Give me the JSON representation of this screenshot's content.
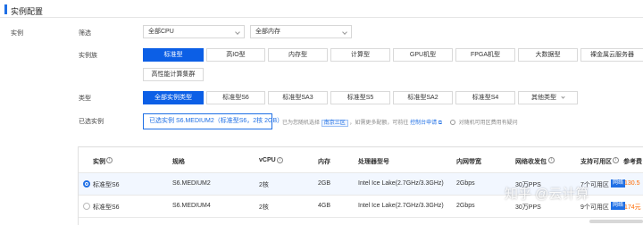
{
  "section": {
    "title": "实例配置"
  },
  "labels": {
    "instance": "实例",
    "filter": "筛选",
    "family": "实例族",
    "type": "类型",
    "selected": "已选实例"
  },
  "filters": {
    "cpu": "全部CPU",
    "mem": "全部内存"
  },
  "families": [
    "标准型",
    "高IO型",
    "内存型",
    "计算型",
    "GPU机型",
    "FPGA机型",
    "大数据型",
    "裸金属云服务器",
    "高性能计算集群"
  ],
  "types": [
    "全部实例类型",
    "标准型S6",
    "标准型SA3",
    "标准型S5",
    "标准型SA2",
    "标准型S4",
    "其他类型"
  ],
  "selected": {
    "text": "已选实例 S6.MEDIUM2（标准型S6，2核 2GB）",
    "note_prefix": "已为您随机选择",
    "zone_tag": "南京三区",
    "note_mid": "，如需更多配额，可前往",
    "note_link": "控制台申请",
    "note2": "对随机可用区费用有疑问"
  },
  "table": {
    "headers": [
      "实例",
      "规格",
      "vCPU",
      "内存",
      "处理器型号",
      "内网带宽",
      "网络收发包",
      "支持可用区",
      "参考费"
    ],
    "rows": [
      {
        "instance": "标准型S6",
        "spec": "S6.MEDIUM2",
        "vcpu": "2核",
        "mem": "2GB",
        "cpu_model": "Intel Ice Lake(2.7GHz/3.3GHz)",
        "bw": "2Gbps",
        "pps": "30万PPS",
        "zones": "7个可用区",
        "badge": "网络",
        "price": "130.5",
        "checked": true
      },
      {
        "instance": "标准型S6",
        "spec": "S6.MEDIUM4",
        "vcpu": "2核",
        "mem": "4GB",
        "cpu_model": "Intel Ice Lake(2.7GHz/3.3GHz)",
        "bw": "2Gbps",
        "pps": "30万PPS",
        "zones": "9个可用区",
        "badge": "网络",
        "price": "174元",
        "checked": false
      }
    ]
  },
  "watermark": "知乎 @云计算",
  "colors": {
    "accent": "#0c5fe6",
    "price": "#ff6a00"
  }
}
